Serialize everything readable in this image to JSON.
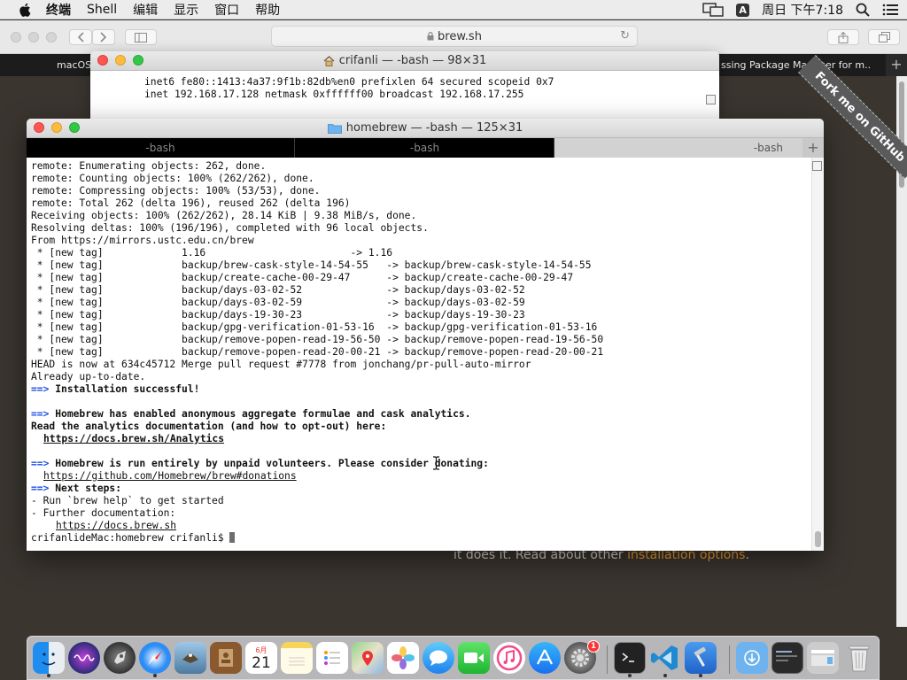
{
  "menubar": {
    "items": [
      "终端",
      "Shell",
      "编辑",
      "显示",
      "窗口",
      "帮助"
    ],
    "ime": "A",
    "clock": "周日 下午7:18"
  },
  "safari": {
    "url": "brew.sh",
    "tabs": [
      {
        "label": "macOS"
      },
      {
        "label": "ssing Package Manager for m..."
      }
    ],
    "ribbon_text": "Fork me on GitHub",
    "page_text": {
      "before": "it does it. Read about other ",
      "link": "installation options",
      "after": "."
    }
  },
  "term_back": {
    "title": "crifanli — -bash — 98×31",
    "lines": [
      "inet6 fe80::1413:4a37:9f1b:82db%en0 prefixlen 64 secured scopeid 0x7",
      "inet 192.168.17.128 netmask 0xffffff00 broadcast 192.168.17.255"
    ]
  },
  "term_front": {
    "title": "homebrew — -bash — 125×31",
    "tabs": [
      "-bash",
      "-bash",
      "-bash"
    ],
    "lines": [
      "remote: Enumerating objects: 262, done.",
      "remote: Counting objects: 100% (262/262), done.",
      "remote: Compressing objects: 100% (53/53), done.",
      "remote: Total 262 (delta 196), reused 262 (delta 196)",
      "Receiving objects: 100% (262/262), 28.14 KiB | 9.38 MiB/s, done.",
      "Resolving deltas: 100% (196/196), completed with 96 local objects.",
      "From https://mirrors.ustc.edu.cn/brew",
      " * [new tag]             1.16                        -> 1.16",
      " * [new tag]             backup/brew-cask-style-14-54-55   -> backup/brew-cask-style-14-54-55",
      " * [new tag]             backup/create-cache-00-29-47      -> backup/create-cache-00-29-47",
      " * [new tag]             backup/days-03-02-52              -> backup/days-03-02-52",
      " * [new tag]             backup/days-03-02-59              -> backup/days-03-02-59",
      " * [new tag]             backup/days-19-30-23              -> backup/days-19-30-23",
      " * [new tag]             backup/gpg-verification-01-53-16  -> backup/gpg-verification-01-53-16",
      " * [new tag]             backup/remove-popen-read-19-56-50 -> backup/remove-popen-read-19-56-50",
      " * [new tag]             backup/remove-popen-read-20-00-21 -> backup/remove-popen-read-20-00-21",
      "HEAD is now at 634c45712 Merge pull request #7778 from jonchang/pr-pull-auto-mirror",
      "Already up-to-date."
    ],
    "arrow": "==>",
    "install_ok": "Installation successful!",
    "analytics_heading": "Homebrew has enabled anonymous aggregate formulae and cask analytics.",
    "analytics_text": "Read the analytics documentation (and how to opt-out) here:",
    "analytics_link": "https://docs.brew.sh/Analytics",
    "donate_heading": "Homebrew is run entirely by unpaid volunteers. Please consider donating:",
    "donate_link": "https://github.com/Homebrew/brew#donations",
    "next_heading": "Next steps:",
    "next_step1": "- Run `brew help` to get started",
    "next_step2": "- Further documentation:",
    "docs_link": "https://docs.brew.sh",
    "prompt": "crifanlideMac:homebrew crifanli$ "
  },
  "dock": {
    "calendar_month": "6月",
    "calendar_day": "21",
    "settings_badge": "1"
  }
}
